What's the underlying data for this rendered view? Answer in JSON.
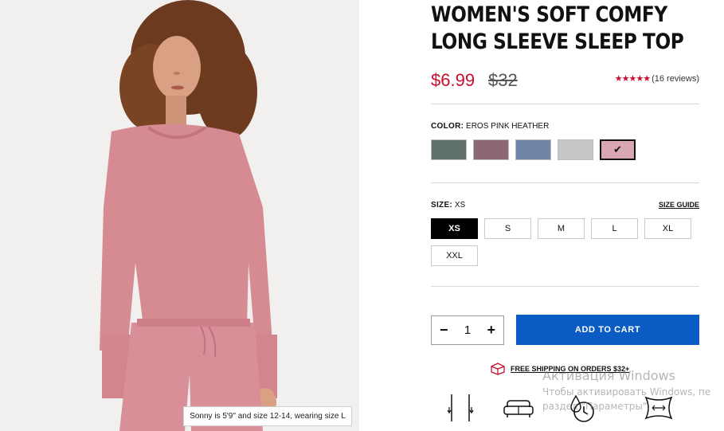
{
  "product": {
    "title_line1": "WOMEN'S SOFT COMFY",
    "title_line2": "LONG SLEEVE SLEEP TOP",
    "sale_price": "$6.99",
    "original_price": "$32",
    "stars": "★★★★★",
    "reviews": "(16 reviews)"
  },
  "photo": {
    "caption": "Sonny is 5'9\" and size 12-14, wearing size L"
  },
  "color": {
    "label": "COLOR:",
    "selected": "EROS PINK HEATHER",
    "swatches": [
      {
        "name": "sage",
        "hex": "#5f7068"
      },
      {
        "name": "mauve",
        "hex": "#8c6872"
      },
      {
        "name": "slate-blue",
        "hex": "#6f86a8"
      },
      {
        "name": "light-gray",
        "hex": "#c6c6c6"
      },
      {
        "name": "eros-pink-heather",
        "hex": "#d9a6b2"
      }
    ]
  },
  "size": {
    "label": "SIZE:",
    "selected": "XS",
    "guide": "SIZE GUIDE",
    "options": [
      "XS",
      "S",
      "M",
      "L",
      "XL",
      "XXL"
    ]
  },
  "cart": {
    "minus": "−",
    "quantity": "1",
    "plus": "+",
    "add_label": "ADD TO CART"
  },
  "shipping": {
    "text": "FREE SHIPPING ON ORDERS $32+"
  },
  "features": [
    "stretch-icon",
    "sofa-icon",
    "quick-dry-icon",
    "softness-icon"
  ],
  "watermark": {
    "line1": "Активация Windows",
    "line2": "Чтобы активировать Windows, пе",
    "line3": "раздел \"Параметры\"."
  },
  "colors": {
    "accent_red": "#c8102e",
    "button_blue": "#0b5bc4",
    "garment_pink": "#d68a92"
  }
}
